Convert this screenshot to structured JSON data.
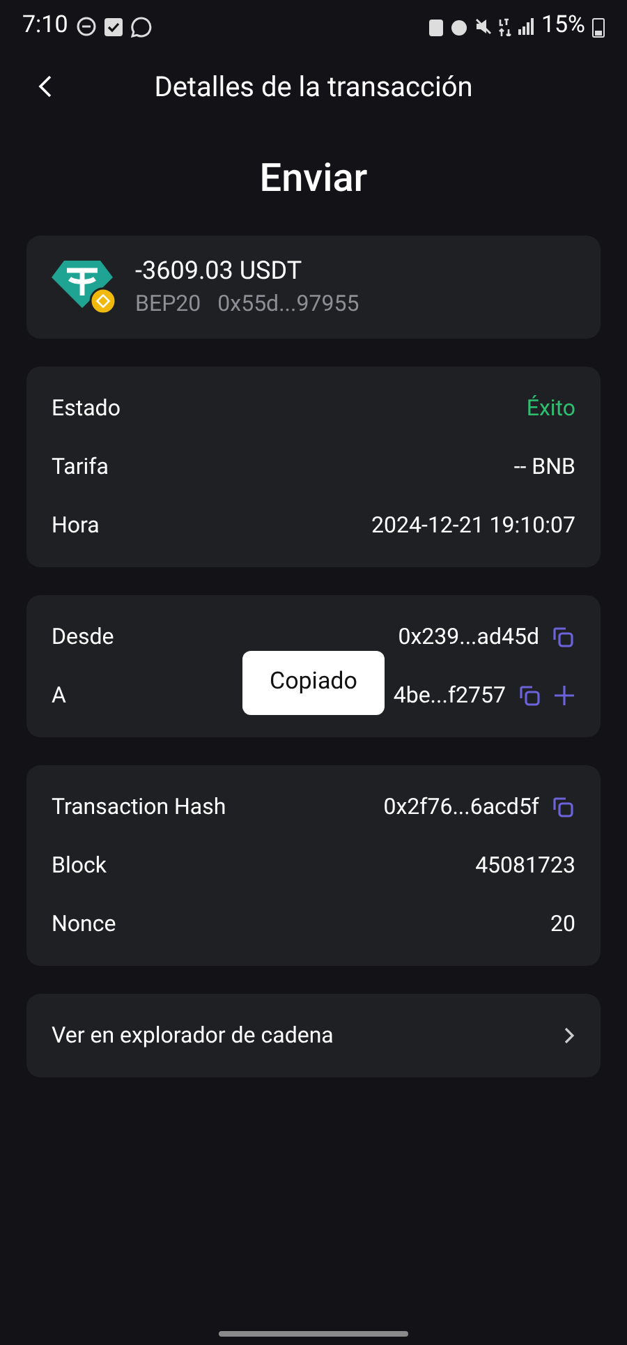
{
  "status_bar": {
    "time": "7:10",
    "battery": "15%"
  },
  "header": {
    "title": "Detalles de la transacción"
  },
  "type_title": "Enviar",
  "asset": {
    "amount": "-3609.03 USDT",
    "network": "BEP20",
    "address": "0x55d...97955"
  },
  "sections": [
    {
      "rows": [
        {
          "label": "Estado",
          "value": "Éxito",
          "kind": "success"
        },
        {
          "label": "Tarifa",
          "value": "-- BNB",
          "kind": "text"
        },
        {
          "label": "Hora",
          "value": "2024-12-21 19:10:07",
          "kind": "text"
        }
      ]
    },
    {
      "rows": [
        {
          "label": "Desde",
          "value": "0x239...ad45d",
          "kind": "address",
          "add": false
        },
        {
          "label": "A",
          "value": "4be...f2757",
          "kind": "address",
          "add": true
        }
      ]
    },
    {
      "rows": [
        {
          "label": "Transaction Hash",
          "value": "0x2f76...6acd5f",
          "kind": "address",
          "add": false
        },
        {
          "label": "Block",
          "value": "45081723",
          "kind": "text"
        },
        {
          "label": "Nonce",
          "value": "20",
          "kind": "text"
        }
      ]
    }
  ],
  "explorer_link": "Ver en explorador de cadena",
  "toast": "Copiado"
}
